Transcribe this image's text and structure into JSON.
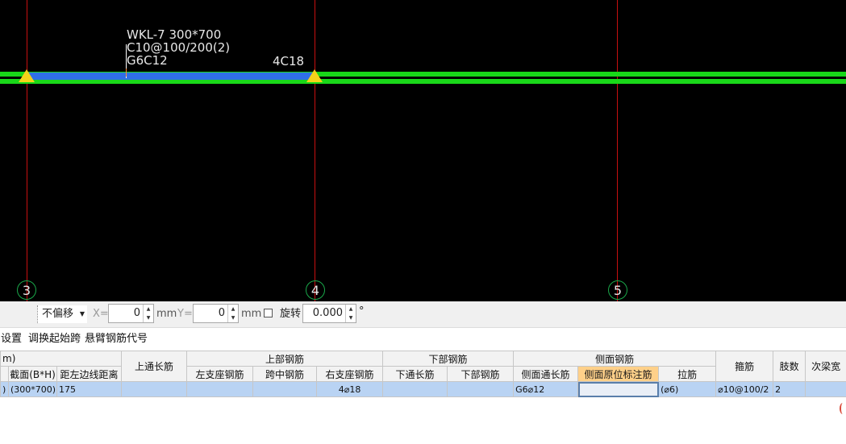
{
  "canvas": {
    "colors": {
      "background": "#000000",
      "axis_line": "#c81010",
      "beam_green": "#19d819",
      "beam_blue": "#2f6fe8",
      "support": "#f4d21a"
    },
    "beam_label": {
      "line1": "WKL-7 300*700",
      "line2": "C10@100/200(2)",
      "line3": "G6C12"
    },
    "span_annotation": "4C18",
    "axis_numbers": [
      "3",
      "4",
      "5"
    ]
  },
  "toolbar": {
    "offset_select": "不偏移",
    "x_label": "X=",
    "x_value": "0",
    "x_unit": "mm",
    "y_label": "Y=",
    "y_value": "0",
    "y_unit": "mm",
    "rotate_label": "旋转",
    "rotate_value": "0.000",
    "degree_symbol": "°"
  },
  "menu": {
    "items": [
      "设置",
      "调换起始跨",
      "悬臂钢筋代号"
    ]
  },
  "grid": {
    "header_top": {
      "partial": "m)",
      "top_continuous": "上通长筋",
      "top_rebar": "上部钢筋",
      "bottom_rebar": "下部钢筋",
      "side_rebar": "侧面钢筋",
      "stirrup": "箍筋",
      "legs": "肢数",
      "secondary": "次梁宽"
    },
    "header_sub": {
      "section": "截面(B*H)",
      "edge_distance": "距左边线距离",
      "left_support": "左支座钢筋",
      "mid_span": "跨中钢筋",
      "right_support": "右支座钢筋",
      "bottom_continuous": "下通长筋",
      "bottom_part": "下部钢筋",
      "side_continuous": "侧面通长筋",
      "side_in_place": "侧面原位标注筋",
      "tie": "拉筋"
    },
    "row": {
      "first": ")",
      "section": "(300*700)",
      "edge_distance": "175",
      "top_continuous": "",
      "left_support": "",
      "mid_span": "",
      "right_support": "4⌀18",
      "bottom_continuous": "",
      "bottom_part": "",
      "side_continuous": "G6⌀12",
      "side_in_place": "",
      "tie": "(⌀6)",
      "stirrup": "⌀10@100/2",
      "legs": "2",
      "secondary": ""
    }
  }
}
